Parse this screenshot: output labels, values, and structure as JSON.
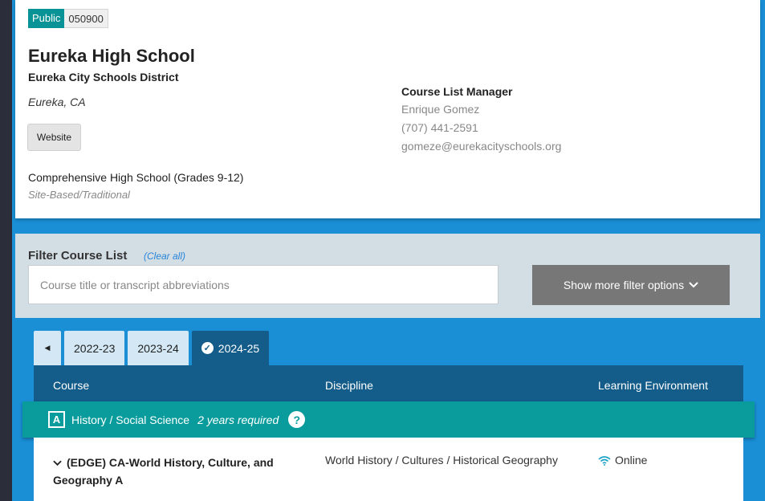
{
  "school": {
    "badge_type": "Public",
    "badge_code": "050900",
    "name": "Eureka High School",
    "district": "Eureka City Schools District",
    "location": "Eureka, CA",
    "website_label": "Website",
    "school_type": "Comprehensive High School (Grades 9-12)",
    "site_type": "Site-Based/Traditional"
  },
  "manager": {
    "label": "Course List Manager",
    "name": "Enrique Gomez",
    "phone": "(707) 441-2591",
    "email": "gomeze@eurekacityschools.org"
  },
  "filter": {
    "title": "Filter Course List",
    "clear_all": "(Clear all)",
    "search_placeholder": "Course title or transcript abbreviations",
    "more_options_label": "Show more filter options"
  },
  "year_tabs": [
    {
      "label": "2022-23",
      "active": false
    },
    {
      "label": "2023-24",
      "active": false
    },
    {
      "label": "2024-25",
      "active": true
    }
  ],
  "table": {
    "headers": {
      "course": "Course",
      "discipline": "Discipline",
      "environment": "Learning Environment"
    },
    "subject": {
      "letter": "A",
      "name": "History / Social Science",
      "requirement": "2 years required"
    },
    "rows": [
      {
        "course": "(EDGE) CA-World History, Culture, and Geography A",
        "discipline": "World History / Cultures / Historical Geography",
        "environment": "Online"
      }
    ]
  },
  "colors": {
    "accent_teal": "#0a9c9c",
    "header_blue": "#145c8a",
    "background_blue": "#1a8fd6"
  }
}
